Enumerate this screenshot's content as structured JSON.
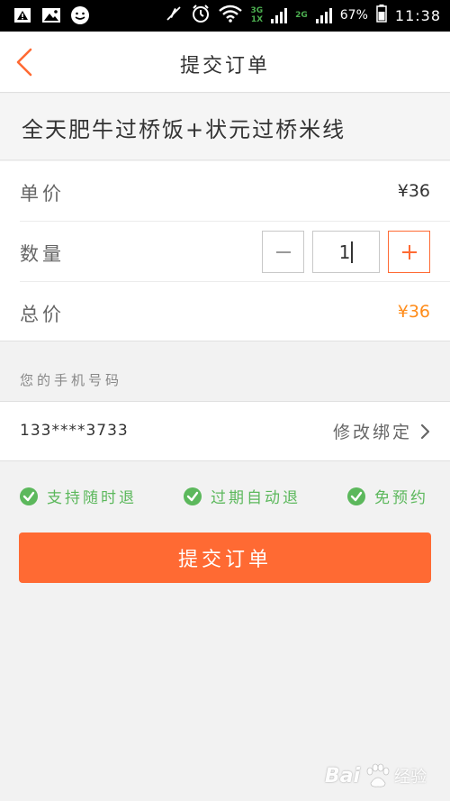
{
  "status_bar": {
    "network_top": "3G",
    "network_bottom": "1X",
    "network2": "2G",
    "battery": "67%",
    "time": "11:38"
  },
  "nav": {
    "title": "提交订单"
  },
  "product": {
    "title": "全天肥牛过桥饭+状元过桥米线"
  },
  "price": {
    "unit_label": "单价",
    "unit_value": "¥36",
    "qty_label": "数量",
    "qty_value": "1",
    "total_label": "总价",
    "total_value": "¥36"
  },
  "phone": {
    "label": "您的手机号码",
    "number": "133****3733",
    "edit_label": "修改绑定"
  },
  "features": [
    {
      "label": "支持随时退"
    },
    {
      "label": "过期自动退"
    },
    {
      "label": "免预约"
    }
  ],
  "submit": {
    "label": "提交订单"
  },
  "watermark": {
    "brand": "Bai",
    "suffix": "经验"
  },
  "colors": {
    "accent": "#ff6a33",
    "price_highlight": "#ff8c1a",
    "feature_green": "#5cb85c"
  }
}
